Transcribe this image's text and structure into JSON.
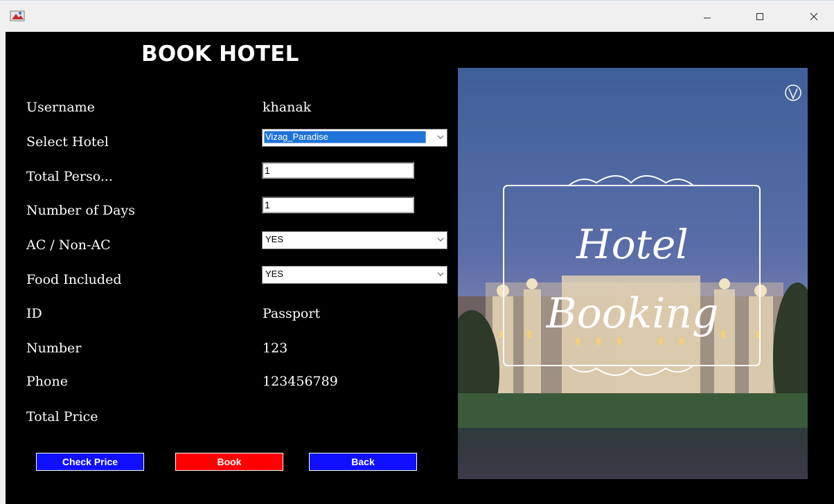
{
  "window": {
    "icon": "app-icon",
    "controls": [
      "minimize-icon",
      "maximize-icon",
      "close-icon"
    ]
  },
  "heading": "BOOK HOTEL",
  "form": {
    "username_label": "Username",
    "username_value": "khanak",
    "hotel_label": "Select Hotel",
    "hotel_value": "Vizag_Paradise",
    "persons_label": "Total Perso...",
    "persons_value": "1",
    "days_label": "Number of Days",
    "days_value": "1",
    "ac_label": "AC / Non-AC",
    "ac_value": "YES",
    "food_label": "Food Included",
    "food_value": "YES",
    "id_label": "ID",
    "id_value": "Passport",
    "number_label": "Number",
    "number_value": "123",
    "phone_label": "Phone",
    "phone_value": "123456789",
    "price_label": "Total Price"
  },
  "buttons": {
    "check_price": "Check Price",
    "book": "Book",
    "back": "Back"
  },
  "poster": {
    "line1": "Hotel",
    "line2": "Booking"
  },
  "colors": {
    "background": "#000000",
    "button_blue": "#1010ff",
    "button_red": "#ff0000",
    "selection": "#1f73d8"
  }
}
